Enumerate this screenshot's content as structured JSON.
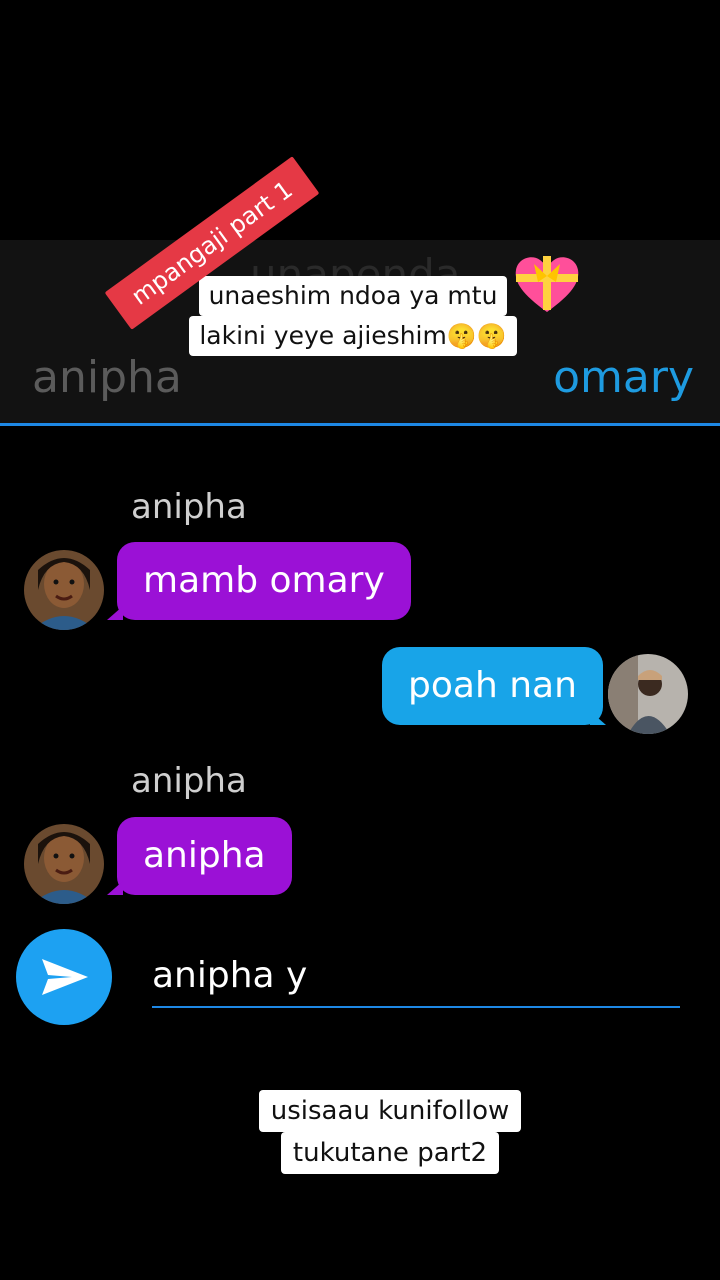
{
  "header": {
    "ghost_title": "unapenda",
    "left_name": "anipha",
    "right_name": "omary"
  },
  "overlay": {
    "caption_line1": "unaeshim ndoa ya mtu",
    "caption_line2": "lakini yeye ajieshim",
    "caption_emoji": "🤫🤫",
    "sticker": "mpangaji part 1",
    "heart_icon": "heart-with-ribbon-icon"
  },
  "messages": [
    {
      "sender": "anipha",
      "text": "mamb omary",
      "direction": "incoming"
    },
    {
      "sender": "omary",
      "text": "poah nan",
      "direction": "outgoing"
    },
    {
      "sender": "anipha",
      "text": "anipha",
      "direction": "incoming"
    }
  ],
  "composer": {
    "value": "anipha y",
    "send_icon": "send-icon"
  },
  "footer": {
    "line1": "usisaau kunifollow",
    "line2": "tukutane part2"
  },
  "colors": {
    "incoming_bubble": "#9b11d6",
    "outgoing_bubble": "#18a4e8",
    "accent": "#1e88e5",
    "sticker": "#e53945"
  }
}
